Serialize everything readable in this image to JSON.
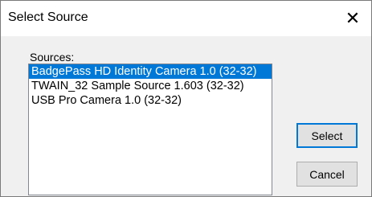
{
  "window": {
    "title": "Select Source",
    "close_glyph": "✕"
  },
  "sources": {
    "label": "Sources:",
    "items": [
      {
        "label": "BadgePass HD Identity Camera 1.0 (32-32)",
        "selected": true
      },
      {
        "label": "TWAIN_32 Sample Source 1.603 (32-32)",
        "selected": false
      },
      {
        "label": "USB Pro Camera 1.0 (32-32)",
        "selected": false
      }
    ]
  },
  "buttons": {
    "select_label": "Select",
    "cancel_label": "Cancel"
  },
  "colors": {
    "selection": "#0078d7",
    "dialog_bg": "#f0f0f0"
  }
}
